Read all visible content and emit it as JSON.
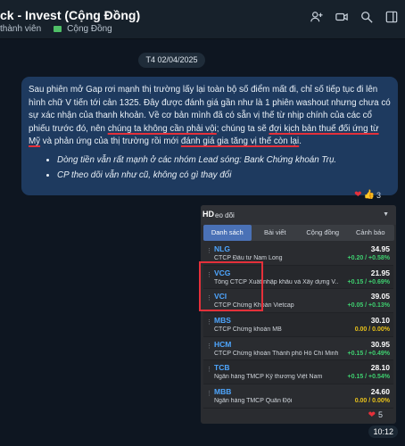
{
  "header": {
    "title": "ck - Invest (Cộng Đồng)",
    "members_label": "thành viên",
    "tag_label": "Cộng Đồng"
  },
  "date_separator": "T4 02/04/2025",
  "message": {
    "p1": "Sau phiên mở Gap rơi mạnh  thị trường lấy lại toàn bộ số điểm mất đi, chỉ số tiếp tục đi lên hình chữ V tiến tới cản 1325. Đây được đánh giá gần như là 1 phiên washout nhưng chưa có sự xác nhận của thanh khoản. Về cơ bản mình đã có sẵn vị thế từ nhịp chính của các cổ phiếu trước đó, nên ",
    "p1_u1": "chúng ta không cần phải vội",
    "p1_mid": "; chúng ta sẽ ",
    "p1_u2": "đợi kịch bản thuế đối ứng từ Mỹ",
    "p1_mid2": " và phản ứng của thị trường rồi mới ",
    "p1_u3": "đánh giá gia tăng vị thế còn lại",
    "p1_end": ".",
    "bullets": [
      "Dòng tiền vẫn rất mạnh ở các nhóm Lead sóng: Bank Chứng khoán Trụ.",
      "CP theo dõi vẫn như cũ, không có gì thay đổi"
    ],
    "reaction_count": "3"
  },
  "watchlist": {
    "badge": "HD",
    "title": "eo dõi",
    "tabs": [
      "Danh sách",
      "Bài viết",
      "Cộng đồng",
      "Cảnh báo"
    ],
    "rows": [
      {
        "symbol": "NLG",
        "name": "CTCP Đầu tư Nam Long",
        "price": "34.95",
        "change": "+0.20 / +0.58%",
        "trend": "up"
      },
      {
        "symbol": "VCG",
        "name": "Tổng CTCP Xuất nhập khẩu và Xây dựng V...",
        "price": "21.95",
        "change": "+0.15 / +0.69%",
        "trend": "up"
      },
      {
        "symbol": "VCI",
        "name": "CTCP Chứng Khoán Vietcap",
        "price": "39.05",
        "change": "+0.05 / +0.13%",
        "trend": "up"
      },
      {
        "symbol": "MBS",
        "name": "CTCP Chứng khoán MB",
        "price": "30.10",
        "change": "0.00 / 0.00%",
        "trend": "flat"
      },
      {
        "symbol": "HCM",
        "name": "CTCP Chứng khoán Thành phố Hồ Chí Minh",
        "price": "30.95",
        "change": "+0.15 / +0.49%",
        "trend": "up"
      },
      {
        "symbol": "TCB",
        "name": "Ngân hàng TMCP Kỹ thương Việt Nam",
        "price": "28.10",
        "change": "+0.15 / +0.54%",
        "trend": "up"
      },
      {
        "symbol": "MBB",
        "name": "Ngân hàng TMCP Quân Đội",
        "price": "24.60",
        "change": "0.00 / 0.00%",
        "trend": "flat"
      }
    ],
    "reaction_count": "5"
  },
  "time": "10:12",
  "colors": {
    "accent": "#4a71b6",
    "up": "#3ecf6f",
    "flat": "#e8c21a",
    "highlight": "#e5303a"
  }
}
